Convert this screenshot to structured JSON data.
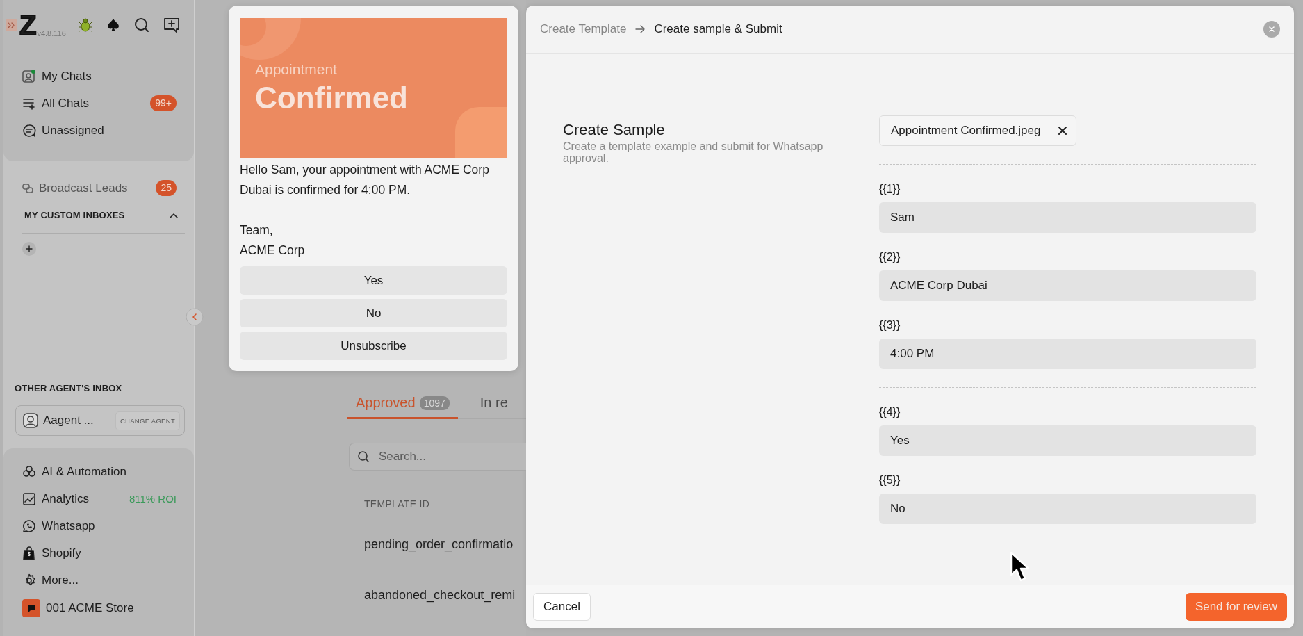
{
  "sidebar": {
    "logo": "Z",
    "version": "v4.8.116",
    "nav": [
      {
        "label": "My Chats"
      },
      {
        "label": "All Chats",
        "badge": "99+"
      },
      {
        "label": "Unassigned"
      }
    ],
    "broadcast": {
      "label": "Broadcast Leads",
      "badge": "25"
    },
    "custom_inboxes": {
      "title": "MY CUSTOM INBOXES",
      "expanded": true
    },
    "other_agent": {
      "title": "OTHER AGENT'S INBOX",
      "agent": "Aagent ...",
      "button": "CHANGE AGENT"
    },
    "apps": [
      {
        "label": "AI & Automation"
      },
      {
        "label": "Analytics",
        "note": "811% ROI"
      },
      {
        "label": "Whatsapp"
      },
      {
        "label": "Shopify"
      },
      {
        "label": "More..."
      }
    ],
    "store": {
      "label": "001 ACME Store"
    }
  },
  "templates": {
    "tabs": [
      {
        "label": "Approved",
        "count": "1097",
        "selected": true
      },
      {
        "label": "In re",
        "selected": false
      }
    ],
    "search": {
      "placeholder": "Search..."
    },
    "table": {
      "columns": [
        "TEMPLATE ID"
      ],
      "rows": [
        [
          "pending_order_confirmatio"
        ],
        [
          "abandoned_checkout_remi"
        ]
      ]
    }
  },
  "preview": {
    "banner": {
      "subtitle": "Appointment",
      "title": "Confirmed"
    },
    "message": [
      "Hello Sam, your appointment with ACME Corp Dubai is confirmed for 4:00 PM.",
      "Team,\nACME Corp"
    ],
    "buttons": [
      "Yes",
      "No",
      "Unsubscribe"
    ]
  },
  "modal": {
    "breadcrumb": [
      "Create Template",
      "Create sample & Submit"
    ],
    "title": "Create Sample",
    "subtitle": "Create a template example and submit for Whatsapp approval.",
    "attachment": "Appointment Confirmed.jpeg",
    "variable_groups": [
      [
        {
          "label": "{{1}}",
          "value": "Sam"
        },
        {
          "label": "{{2}}",
          "value": "ACME Corp Dubai"
        },
        {
          "label": "{{3}}",
          "value": "4:00 PM"
        }
      ],
      [
        {
          "label": "{{4}}",
          "value": "Yes"
        },
        {
          "label": "{{5}}",
          "value": "No"
        }
      ]
    ],
    "footer": {
      "cancel": "Cancel",
      "submit": "Send for review"
    }
  }
}
